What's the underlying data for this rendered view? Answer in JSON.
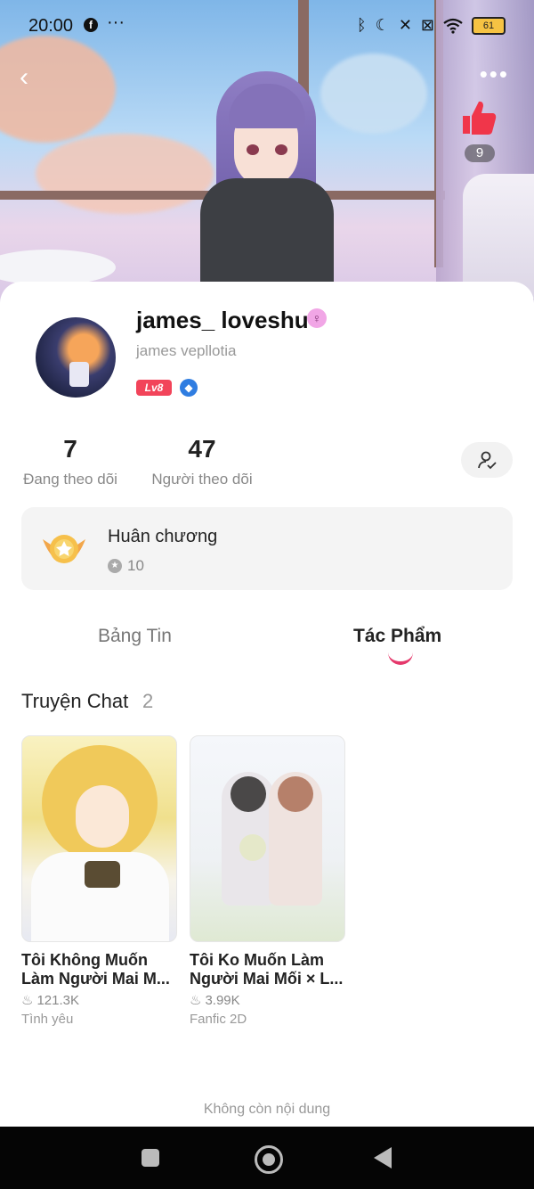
{
  "status_bar": {
    "time": "20:00",
    "battery_level": "61",
    "icons": [
      "facebook-icon",
      "bluetooth-icon",
      "moon-icon",
      "vibrate-off-icon",
      "sim-icon",
      "wifi-icon",
      "battery-icon"
    ]
  },
  "header": {
    "like_count": "9"
  },
  "profile": {
    "username": "james_ loveshu",
    "subname": "james vepllotia",
    "level": "Lv8"
  },
  "stats": {
    "following_count": "7",
    "following_label": "Đang theo dõi",
    "followers_count": "47",
    "followers_label": "Người theo dõi"
  },
  "medal": {
    "title": "Huân chương",
    "count": "10"
  },
  "tabs": {
    "news": "Bảng Tin",
    "works": "Tác Phẩm",
    "active": "works"
  },
  "section": {
    "title": "Truyện Chat",
    "count": "2"
  },
  "stories": [
    {
      "title": "Tôi Không Muốn Làm Người Mai M...",
      "views": "121.3K",
      "genre": "Tình yêu"
    },
    {
      "title": "Tôi Ko Muốn Làm Người Mai Mối × L...",
      "views": "3.99K",
      "genre": "Fanfic 2D"
    }
  ],
  "footer": {
    "end_text": "Không còn nội dung"
  },
  "colors": {
    "accent": "#e5386b",
    "level_badge": "#f2445a",
    "like": "#f0364a"
  }
}
